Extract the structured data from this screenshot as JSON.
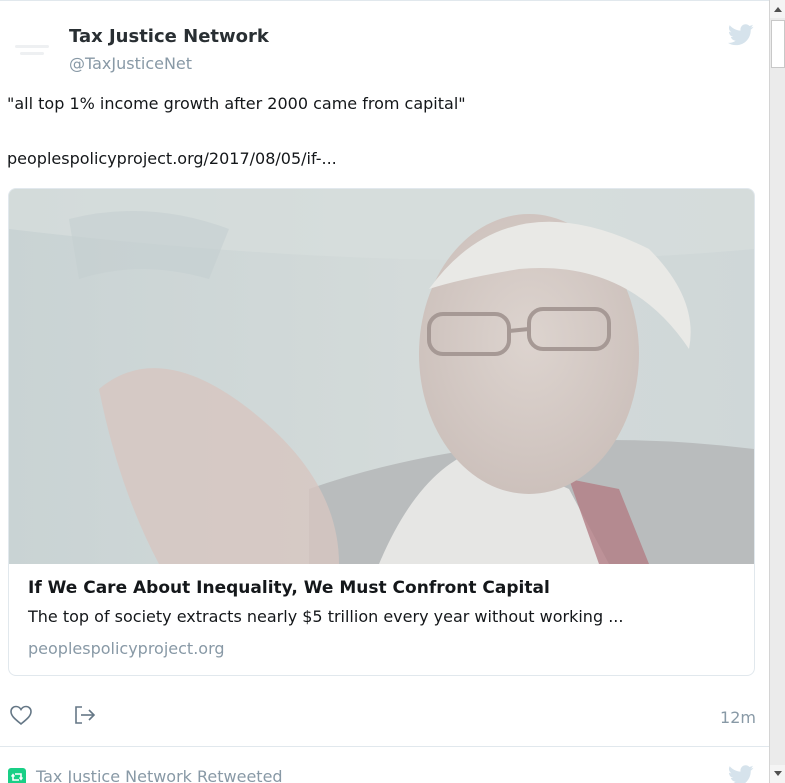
{
  "tweet": {
    "author_name": "Tax Justice Network",
    "author_handle": "@TaxJusticeNet",
    "text_line_1": "\"all top 1% income growth after 2000 came from capital\"",
    "text_line_2": "peoplespolicyproject.org/2017/08/05/if-...",
    "card": {
      "title": "If We Care About Inequality, We Must Confront Capital",
      "description": "The top of society extracts nearly $5 trillion every year without working ...",
      "domain": "peoplespolicyproject.org"
    },
    "timestamp": "12m",
    "icons": {
      "bird": "twitter-bird-icon",
      "like": "heart-icon",
      "share": "share-icon"
    }
  },
  "next_tweet": {
    "retweet_label": "Tax Justice Network Retweeted",
    "icon": "retweet-icon"
  },
  "colors": {
    "secondary_text": "#8899a6",
    "retweet_green": "#19cf86",
    "border": "#e1e8ed"
  }
}
